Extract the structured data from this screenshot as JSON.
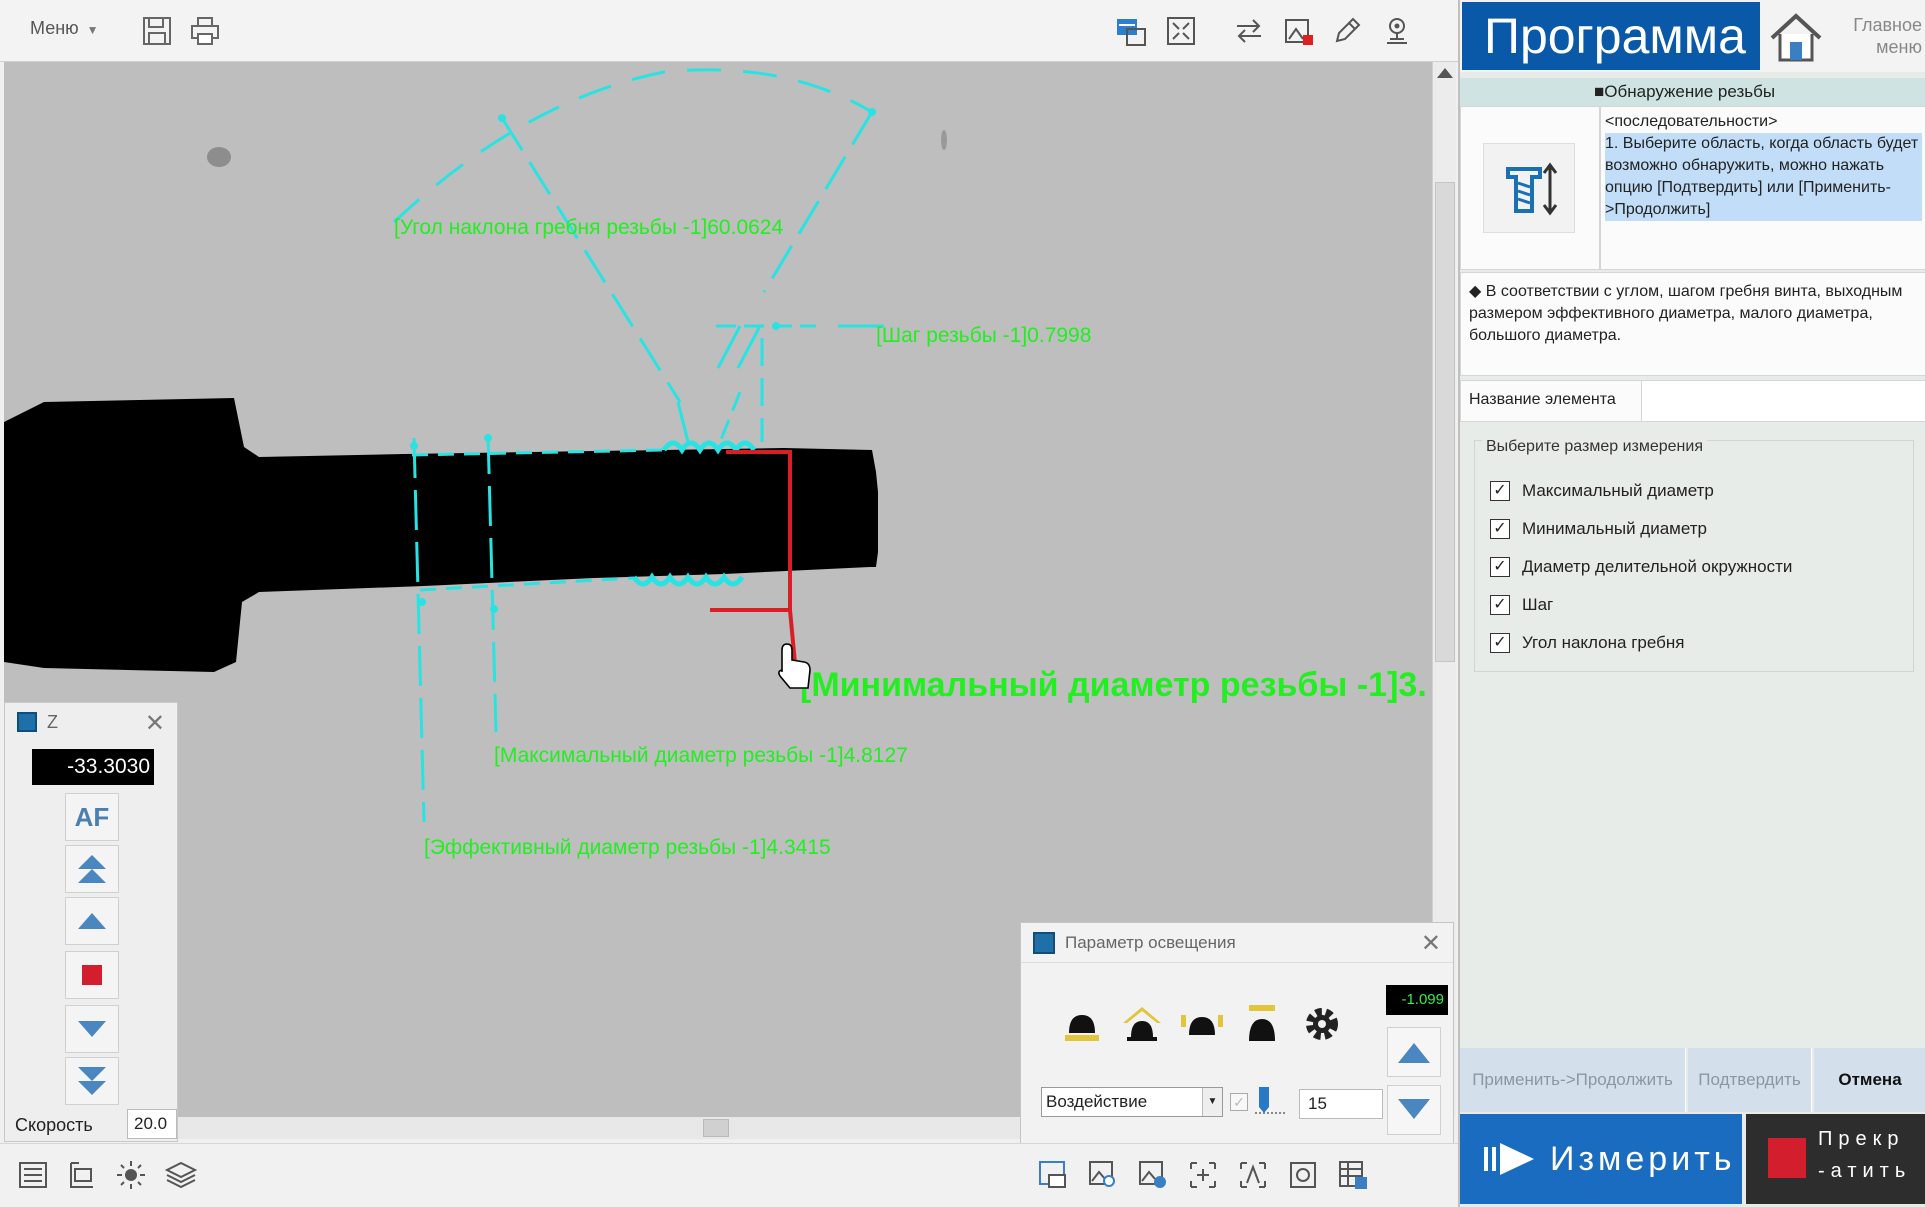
{
  "toolbar": {
    "menu_label": "Меню",
    "icons": [
      "save-icon",
      "print-icon",
      "edge-detect-icon",
      "fit-screen-icon",
      "swap-icon",
      "image-capture-icon",
      "pencil-icon",
      "location-pin-icon"
    ]
  },
  "viewport": {
    "measurements": {
      "angle": "[Угол наклона гребня резьбы -1]60.0624",
      "pitch": "[Шаг резьбы -1]0.7998",
      "minor": "[Минимальный диаметр резьбы -1]3.",
      "major": "[Максимальный диаметр резьбы -1]4.8127",
      "pitch_diameter": "[Эффективный диаметр резьбы -1]4.3415"
    },
    "colors": {
      "overlay": "#29e3e3",
      "text": "#22ee22",
      "red": "#d81f26"
    }
  },
  "z_panel": {
    "title": "Z",
    "value": "-33.3030",
    "af_label": "AF",
    "speed_label": "Скорость",
    "speed_value": "20.0"
  },
  "lighting_panel": {
    "title": "Параметр освещения",
    "readout": "-1.099",
    "mode": "Воздействие",
    "value": "15"
  },
  "right_panel": {
    "title": "Программа",
    "home_label_1": "Главное",
    "home_label_2": "меню",
    "section": "■Обнаружение резьбы",
    "sequence_header": "<последовательности>",
    "sequence_step": "1. Выберите область, когда область будет возможно обнаружить, можно нажать опцию [Подтвердить] или [Применить->Продолжить]",
    "description": "◆ В соответствии с углом, шагом гребня винта, выходным размером эффективного диаметра, малого диаметра, большого диаметра.",
    "element_name_label": "Название элемента",
    "group_title": "Выберите размер измерения",
    "options": [
      {
        "label": "Максимальный диаметр",
        "checked": true
      },
      {
        "label": "Минимальный диаметр",
        "checked": true
      },
      {
        "label": "Диаметр делительной окружности",
        "checked": true
      },
      {
        "label": "Шаг",
        "checked": true
      },
      {
        "label": "Угол наклона гребня",
        "checked": true
      }
    ],
    "apply_label": "Применить->Продолжить",
    "confirm_label": "Подтвердить",
    "cancel_label": "Отмена",
    "measure_label": "Измерить",
    "stop_label_1": "Прекр",
    "stop_label_2": "-атить"
  }
}
